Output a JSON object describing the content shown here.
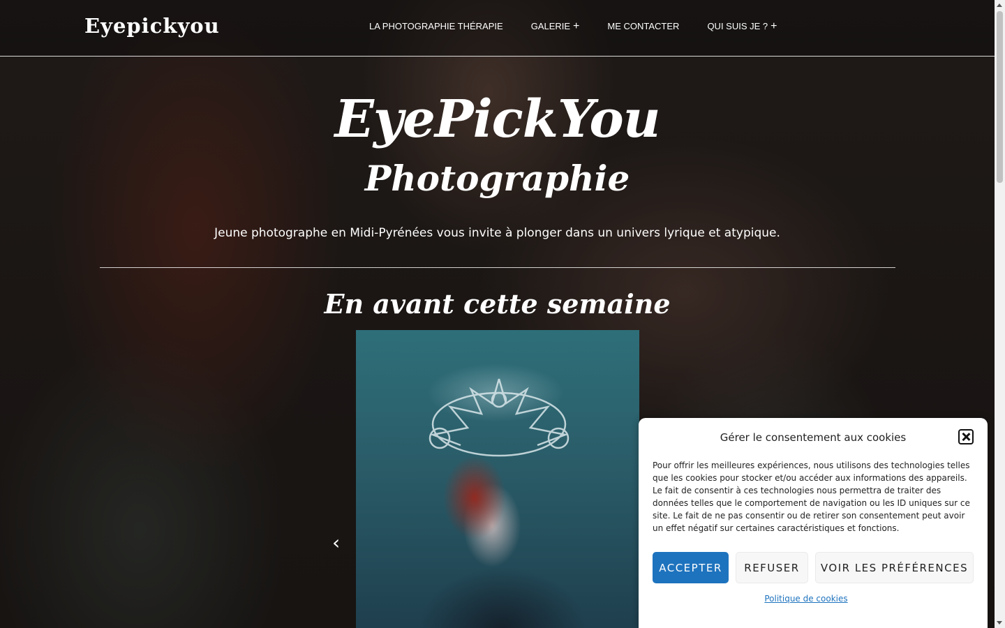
{
  "header": {
    "logo": "Eyepickyou",
    "nav": [
      {
        "label": "LA PHOTOGRAPHIE THÉRAPIE",
        "has_submenu": false
      },
      {
        "label": "GALERIE",
        "has_submenu": true
      },
      {
        "label": "ME CONTACTER",
        "has_submenu": false
      },
      {
        "label": "QUI SUIS JE ?",
        "has_submenu": true
      }
    ],
    "submenu_symbol": "+"
  },
  "hero": {
    "title": "EyePickYou",
    "subtitle": "Photographie",
    "tagline": "Jeune photographe en Midi-Pyrénées vous invite à plonger dans un univers lyrique et atypique."
  },
  "featured": {
    "title": "En avant cette semaine",
    "prev_icon": "chevron-left-icon"
  },
  "cookie_banner": {
    "title": "Gérer le consentement aux cookies",
    "text": "Pour offrir les meilleures expériences, nous utilisons des technologies telles que les cookies pour stocker et/ou accéder aux informations des appareils. Le fait de consentir à ces technologies nous permettra de traiter des données telles que le comportement de navigation ou les ID uniques sur ce site. Le fait de ne pas consentir ou de retirer son consentement peut avoir un effet négatif sur certaines caractéristiques et fonctions.",
    "accept_label": "ACCEPTER",
    "refuse_label": "REFUSER",
    "prefs_label": "VOIR LES PRÉFÉRENCES",
    "policy_link": "Politique de cookies",
    "close_icon": "close-icon",
    "accent_color": "#1e73be"
  }
}
